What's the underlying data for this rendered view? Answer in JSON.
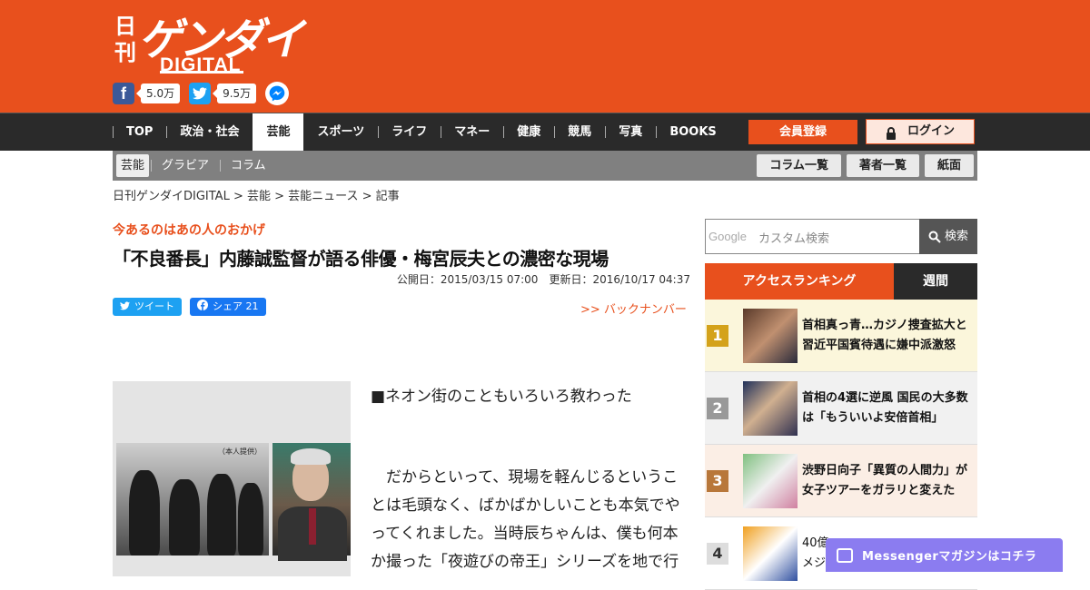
{
  "brand": {
    "nikkan": "日刊",
    "gendai": "ゲンダイ",
    "digital": "DIGITAL"
  },
  "social": {
    "facebook_count": "5.0万",
    "twitter_count": "9.5万"
  },
  "nav": {
    "items": [
      "TOP",
      "政治・社会",
      "芸能",
      "スポーツ",
      "ライフ",
      "マネー",
      "健康",
      "競馬",
      "写真",
      "BOOKS"
    ],
    "active": "芸能",
    "register_label": "会員登録",
    "login_label": "ログイン"
  },
  "subnav": {
    "items": [
      "芸能",
      "グラビア",
      "コラム"
    ],
    "buttons": [
      "コラム一覧",
      "著者一覧",
      "紙面"
    ]
  },
  "breadcrumb": "日刊ゲンダイDIGITAL > 芸能 > 芸能ニュース > 記事",
  "article": {
    "kicker": "今あるのはあの人のおかげ",
    "title": "「不良番長」内藤誠監督が語る俳優・梅宮辰夫との濃密な現場",
    "published": "公開日：2015/03/15 07:00",
    "updated": "更新日：2016/10/17 04:37",
    "tweet_label": "ツイート",
    "share_label": "シェア 21",
    "backnumber": ">> バックナンバー",
    "photo_credit": "（本人提供）",
    "heading": "■ネオン街のこともいろいろ教わった",
    "paragraph": "だからといって、現場を軽んじるということは毛頭なく、ばかばかしいことも本気でやってくれました。当時辰ちゃんは、僕も何本か撮った「夜遊びの帝王」シリーズを地で行"
  },
  "search": {
    "google_label": "Google",
    "placeholder": "カスタム検索",
    "button": "検索"
  },
  "ranking": {
    "tab_access": "アクセスランキング",
    "tab_week": "週間",
    "items": [
      {
        "rank": "1",
        "title": "首相真っ青…カジノ捜査拡大と習近平国賓待遇に嫌中派激怒"
      },
      {
        "rank": "2",
        "title": "首相の4選に逆風 国民の大多数は「もういいよ安倍首相」"
      },
      {
        "rank": "3",
        "title": "渋野日向子「異質の人間力」が女子ツアーをガラリと変えた"
      },
      {
        "rank": "4",
        "title": "40億\nメジ"
      }
    ]
  },
  "messenger": {
    "label": "Messengerマガジンはコチラ"
  },
  "colors": {
    "brand_orange": "#e8501d",
    "nav_dark": "#2a2a2a",
    "messenger_purple": "#8b7cf0"
  }
}
